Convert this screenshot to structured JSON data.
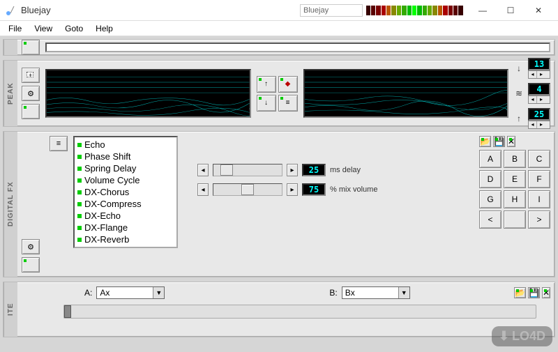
{
  "window": {
    "title": "Bluejay",
    "vu_label": "Bluejay"
  },
  "menubar": {
    "file": "File",
    "view": "View",
    "goto": "Goto",
    "help": "Help"
  },
  "panels": {
    "peak": {
      "label": "PEAK",
      "readouts": {
        "top": "13",
        "mid": "4",
        "bot": "25"
      }
    },
    "fx": {
      "label": "DIGITAL FX",
      "effects": [
        "Echo",
        "Phase Shift",
        "Spring Delay",
        "Volume Cycle",
        "DX-Chorus",
        "DX-Compress",
        "DX-Echo",
        "DX-Flange",
        "DX-Reverb"
      ],
      "sliders": {
        "delay": {
          "value": "25",
          "label": "ms delay",
          "pos": 10
        },
        "mix": {
          "value": "75",
          "label": "% mix volume",
          "pos": 40
        }
      },
      "filebtns": {
        "open": "📂",
        "save": "💾",
        "close": "✕"
      },
      "keypad": [
        "A",
        "B",
        "C",
        "D",
        "E",
        "F",
        "G",
        "H",
        "I",
        "<",
        "",
        ">"
      ]
    },
    "ite": {
      "label": "ITE",
      "a_label": "A:",
      "a_value": "Ax",
      "b_label": "B:",
      "b_value": "Bx",
      "filebtns": {
        "open": "📂",
        "save": "💾",
        "close": "✕"
      }
    }
  },
  "watermark": "LO4D"
}
